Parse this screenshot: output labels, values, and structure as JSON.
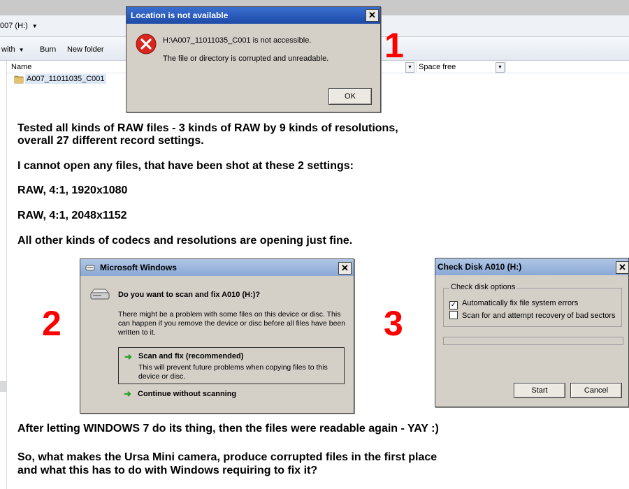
{
  "explorer": {
    "address_text": "007 (H:)",
    "toolbar": {
      "share_with_label": "with",
      "burn_label": "Burn",
      "new_folder_label": "New folder"
    },
    "columns": {
      "name": "Name",
      "space_free": "Space free"
    },
    "folder_item": "A007_11011035_C001"
  },
  "dialog1": {
    "title": "Location is not available",
    "close": "✕",
    "message_line1": "H:\\A007_11011035_C001 is not accessible.",
    "message_line2": "The file or directory is corrupted and unreadable.",
    "ok_label": "OK",
    "icon": "error-icon"
  },
  "dialog2": {
    "title": "Microsoft Windows",
    "close": "✕",
    "question": "Do you want to scan and fix A010 (H:)?",
    "body": "There might be a problem with some files on this device or disc. This can happen if you remove the device or disc before all files have been written to it.",
    "option1_title": "Scan and fix (recommended)",
    "option1_sub": "This will prevent future problems when copying files to this device or disc.",
    "option2_title": "Continue without scanning",
    "option_arrow": "➜"
  },
  "dialog3": {
    "title": "Check Disk A010 (H:)",
    "close": "✕",
    "group_label": "Check disk options",
    "option1_label": "Automatically fix file system errors",
    "option1_checked": true,
    "option2_label": "Scan for and attempt recovery of bad sectors",
    "option2_checked": false,
    "progress": 0,
    "start_label": "Start",
    "cancel_label": "Cancel"
  },
  "text": {
    "para1_line1": "Tested all kinds of RAW files - 3 kinds of RAW by 9 kinds of resolutions,",
    "para1_line2": "overall 27 different record settings.",
    "para2": "I cannot open any files, that have been shot at these 2 settings:",
    "setting1": "RAW, 4:1, 1920x1080",
    "setting2": "RAW, 4:1, 2048x1152",
    "para3": "All other kinds of codecs and resolutions are opening just fine.",
    "para4": "After letting WINDOWS 7 do its thing, then the files were readable again - YAY :)",
    "para5_line1": "So, what makes the Ursa Mini camera, produce corrupted files in the first place",
    "para5_line2": "and what this has to do with Windows requiring to fix it?"
  },
  "step_numbers": {
    "one": "1",
    "two": "2",
    "three": "3"
  },
  "colors": {
    "step_number": "#ff0000",
    "dialog_face": "#d4d0c8",
    "title_active": "#1d4aa6",
    "title_inactive": "#8aa8d6"
  }
}
